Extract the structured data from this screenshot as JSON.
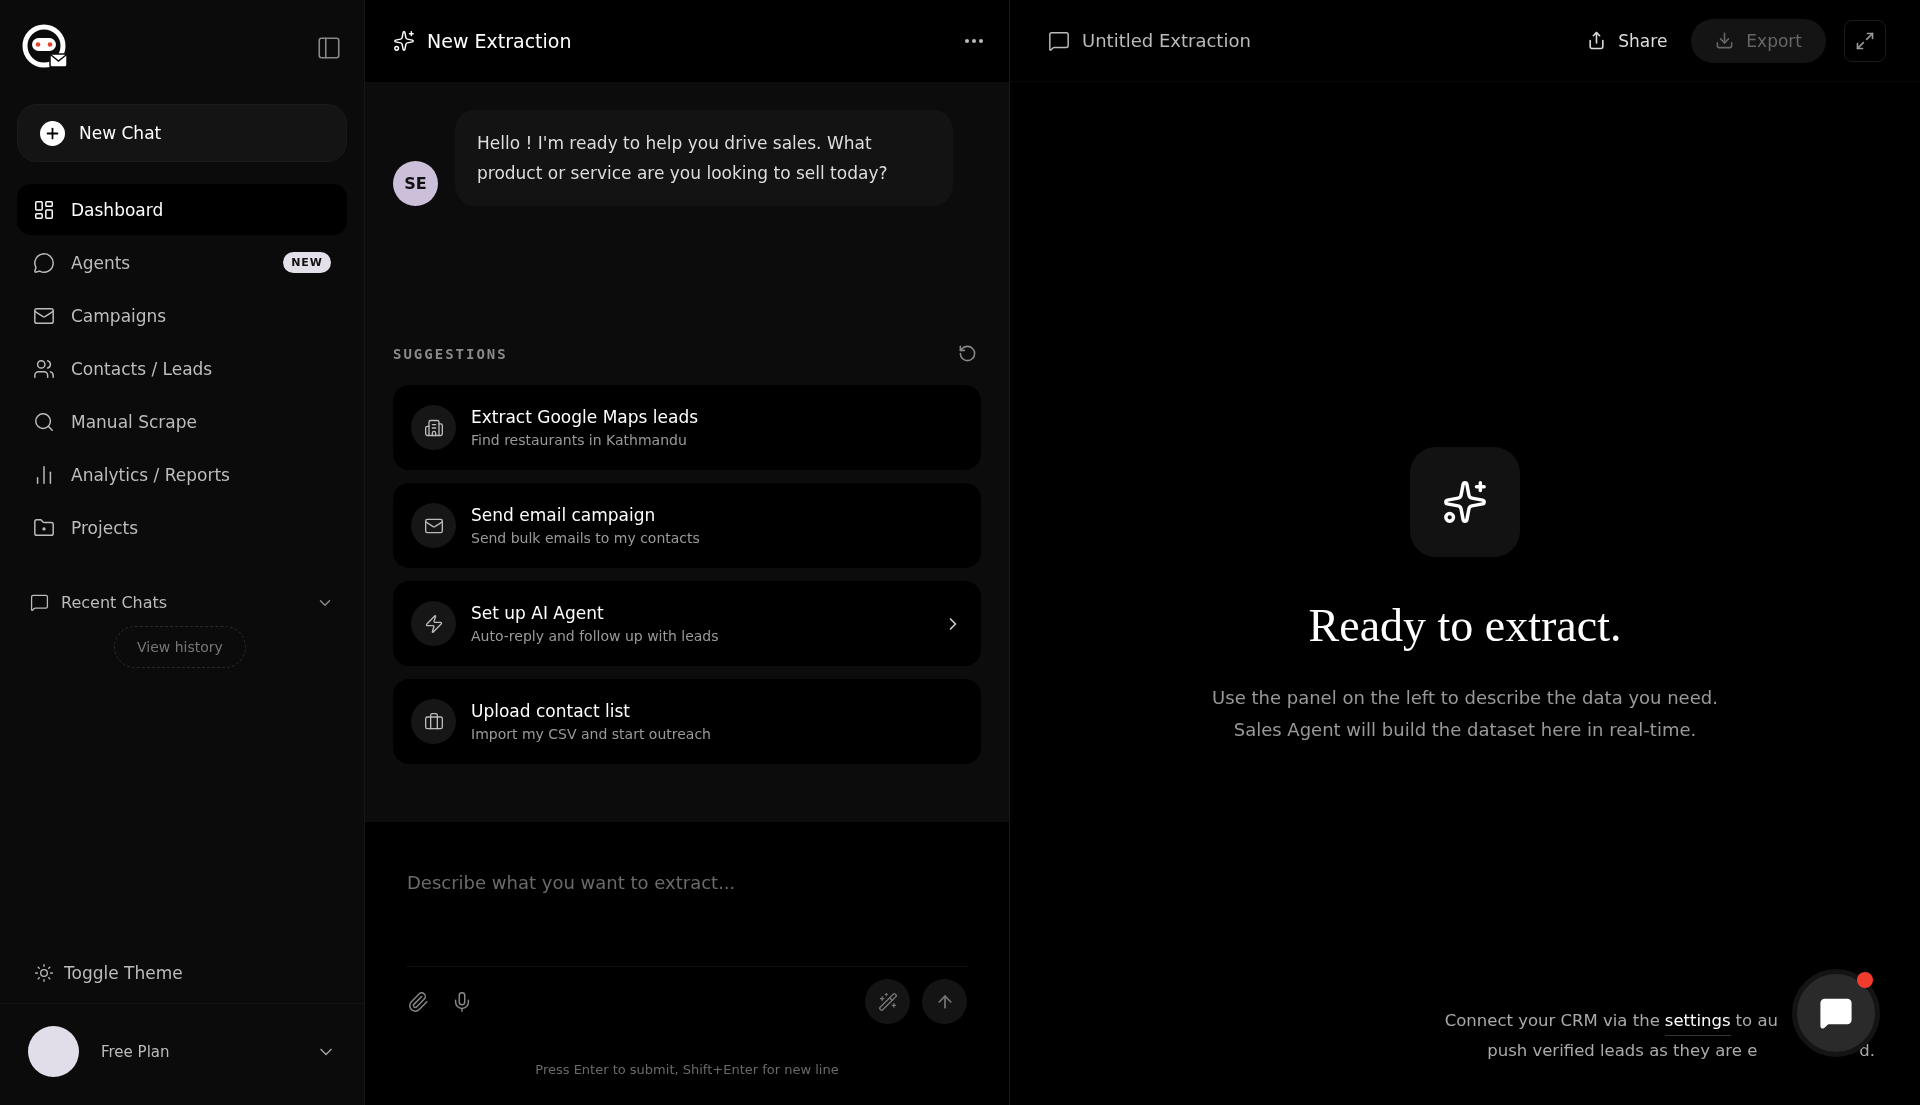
{
  "sidebar": {
    "new_chat": "New Chat",
    "nav": [
      {
        "label": "Dashboard",
        "selected": true
      },
      {
        "label": "Agents",
        "selected": false,
        "badge": "NEW"
      },
      {
        "label": "Campaigns",
        "selected": false
      },
      {
        "label": "Contacts / Leads",
        "selected": false
      },
      {
        "label": "Manual Scrape",
        "selected": false
      },
      {
        "label": "Analytics / Reports",
        "selected": false
      },
      {
        "label": "Projects",
        "selected": false
      }
    ],
    "recent_chats": {
      "title": "Recent Chats",
      "button": "View history"
    },
    "toggle_theme": "Toggle Theme",
    "profile": {
      "plan": "Free Plan"
    }
  },
  "chat": {
    "title": "New Extraction",
    "message": {
      "avatar": "SE",
      "text": "Hello ! I'm ready to help you drive sales. What product or service are you looking to sell today?"
    },
    "suggestions_title": "SUGGESTIONS",
    "suggestions": [
      {
        "title": "Extract Google Maps leads",
        "subtitle": "Find restaurants in Kathmandu",
        "arrow": false
      },
      {
        "title": "Send email campaign",
        "subtitle": "Send bulk emails to my contacts",
        "arrow": false
      },
      {
        "title": "Set up AI Agent",
        "subtitle": "Auto-reply and follow up with leads",
        "arrow": true
      },
      {
        "title": "Upload contact list",
        "subtitle": "Import my CSV and start outreach",
        "arrow": false
      }
    ],
    "input": {
      "placeholder": "Describe what you want to extract..."
    },
    "hint": "Press Enter to submit, Shift+Enter for new line"
  },
  "preview": {
    "title": "Untitled Extraction",
    "share": "Share",
    "export": {
      "label": "Export",
      "disabled": true
    },
    "empty_title": "Ready to extract.",
    "empty_text": [
      "Use the panel on the left to describe the data you need.",
      "Sales Agent will build the dataset here in real-time."
    ],
    "crm_note": {
      "before": "Connect your CRM via the",
      "link": "settings",
      "after": "to au",
      "line2": "push verified leads as they are e",
      "tail": "d."
    },
    "chat_widget": {
      "unread": true
    }
  }
}
